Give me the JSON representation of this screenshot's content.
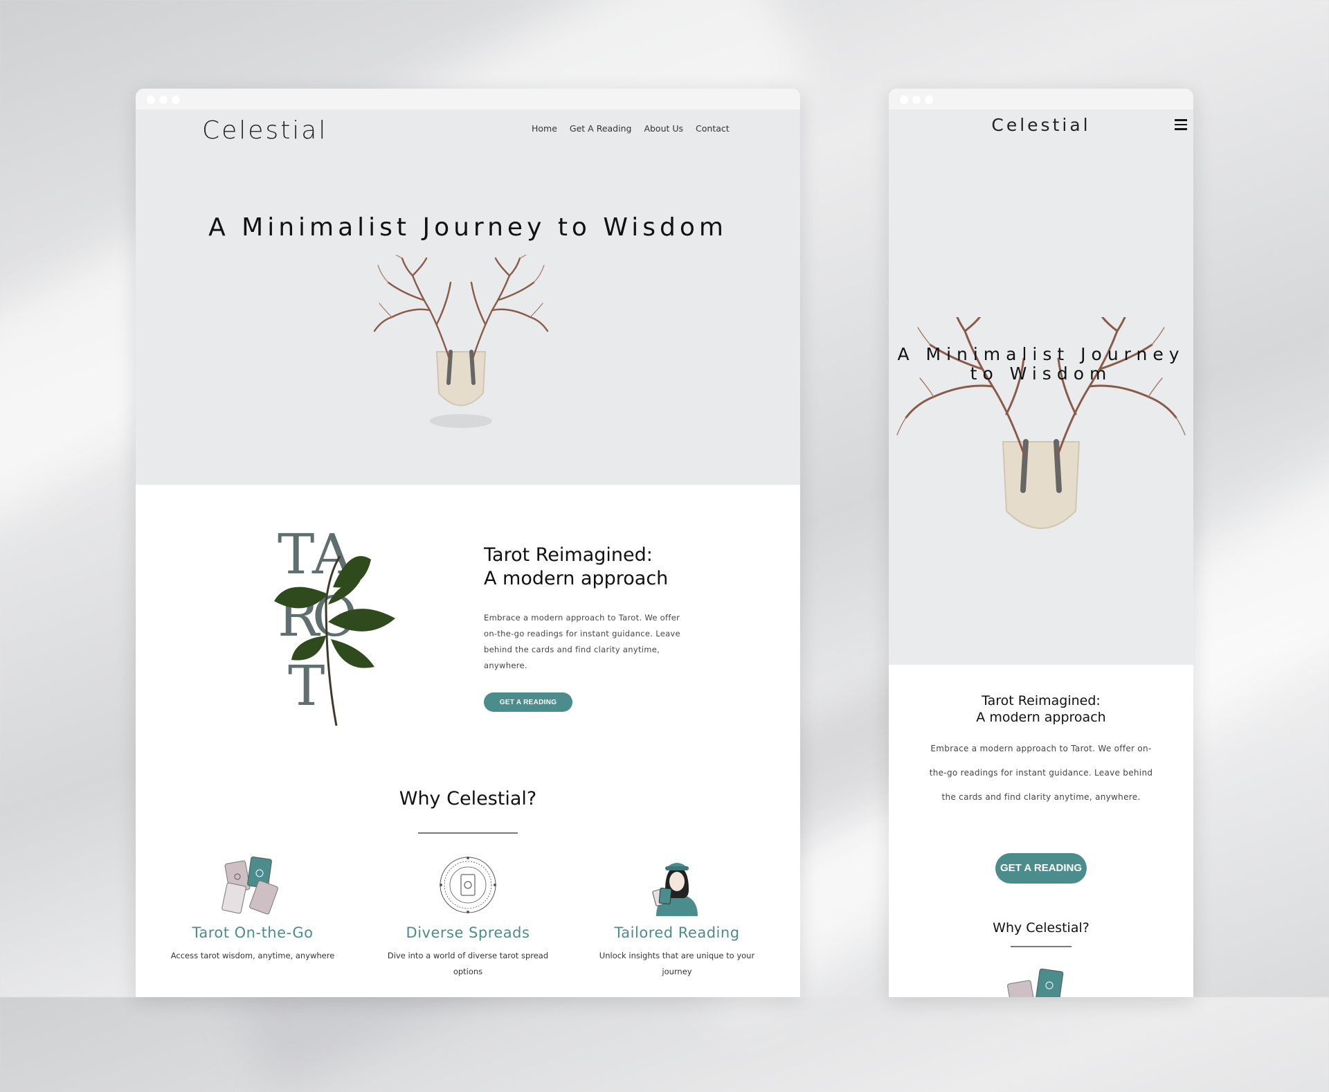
{
  "desktop": {
    "logo": "Celestial",
    "nav": [
      "Home",
      "Get A Reading",
      "About Us",
      "Contact"
    ],
    "hero_title": "A Minimalist Journey to Wisdom",
    "tarot_art_letters": [
      "T",
      "A",
      "R",
      "O",
      "T"
    ],
    "intro": {
      "title_line1": "Tarot Reimagined:",
      "title_line2": "A modern approach",
      "body": "Embrace a modern approach to Tarot. We offer on-the-go readings for instant guidance. Leave behind the cards and find clarity anytime, anywhere.",
      "button": "GET A READING"
    },
    "why_title": "Why Celestial?",
    "features": [
      {
        "title": "Tarot On-the-Go",
        "desc": "Access tarot wisdom, anytime, anywhere",
        "icon": "tarot-cards-icon"
      },
      {
        "title": "Diverse Spreads",
        "desc": "Dive into a world of diverse tarot spread options",
        "icon": "celestial-spread-icon"
      },
      {
        "title": "Tailored Reading",
        "desc": "Unlock insights that are unique to your journey",
        "icon": "fortune-teller-icon"
      }
    ]
  },
  "mobile": {
    "logo": "Celestial",
    "menu_icon": "hamburger-menu-icon",
    "hero_title": "A Minimalist Journey to Wisdom",
    "intro": {
      "title_line1": "Tarot Reimagined:",
      "title_line2": "A modern approach",
      "body": "Embrace a modern approach to Tarot. We offer on-the-go readings for instant guidance. Leave behind the cards and find clarity anytime, anywhere.",
      "button": "GET A READING"
    },
    "why_title": "Why Celestial?"
  },
  "colors": {
    "accent": "#4b8d8c",
    "hero_bg": "#e8eaeb",
    "text": "#111111",
    "tarot_letters": "#5f6f70"
  }
}
